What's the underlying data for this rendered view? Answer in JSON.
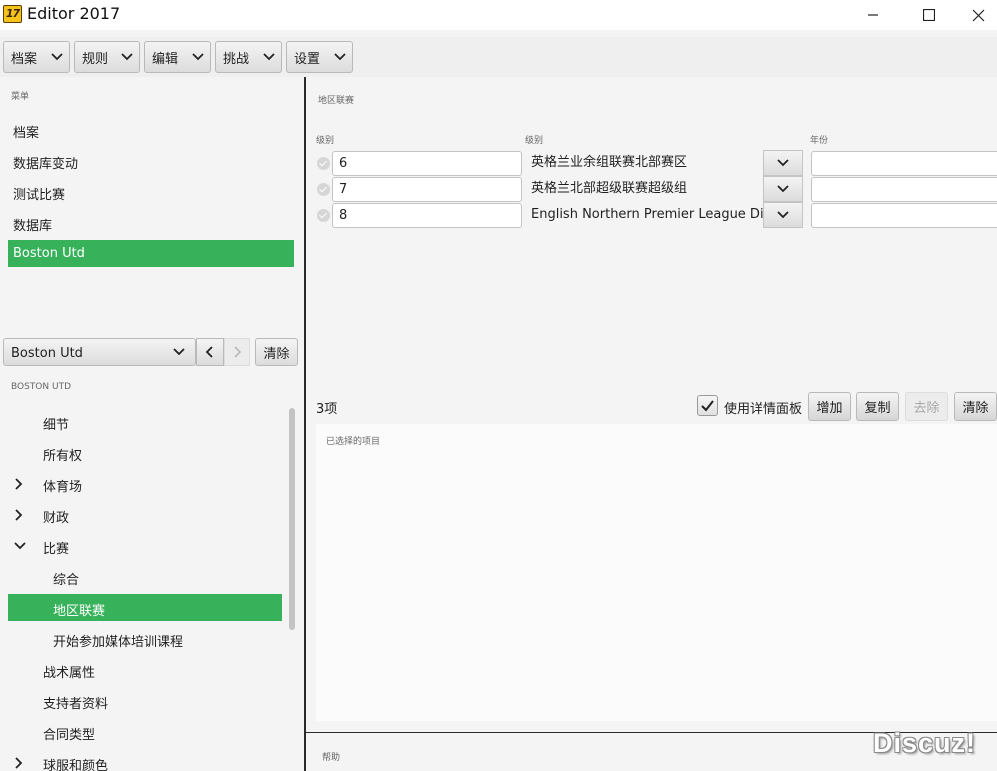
{
  "window": {
    "logo_text": "17",
    "title": "Editor 2017"
  },
  "top_menu": [
    {
      "label": "档案"
    },
    {
      "label": "规则"
    },
    {
      "label": "编辑"
    },
    {
      "label": "挑战"
    },
    {
      "label": "设置"
    }
  ],
  "sidebar": {
    "section_label": "菜单",
    "items": [
      {
        "label": "档案"
      },
      {
        "label": "数据库变动"
      },
      {
        "label": "测试比赛"
      },
      {
        "label": "数据库"
      },
      {
        "label": "Boston Utd"
      }
    ],
    "club_select": "Boston Utd",
    "clear_label": "清除",
    "club_header": "BOSTON UTD",
    "tree": [
      {
        "label": "细节",
        "expander": ""
      },
      {
        "label": "所有权",
        "expander": ""
      },
      {
        "label": "体育场",
        "expander": "collapsed"
      },
      {
        "label": "财政",
        "expander": "collapsed"
      },
      {
        "label": "比赛",
        "expander": "expanded"
      },
      {
        "label": "综合",
        "expander": ""
      },
      {
        "label": "地区联赛",
        "expander": ""
      },
      {
        "label": "开始参加媒体培训课程",
        "expander": ""
      },
      {
        "label": "战术属性",
        "expander": ""
      },
      {
        "label": "支持者资料",
        "expander": ""
      },
      {
        "label": "合同类型",
        "expander": ""
      },
      {
        "label": "球服和颜色",
        "expander": "collapsed"
      }
    ]
  },
  "main": {
    "section_title": "地区联赛",
    "columns": {
      "level": "级别",
      "league": "级别",
      "year": "年份"
    },
    "rows": [
      {
        "level": "6",
        "league": "英格兰业余组联赛北部赛区",
        "year": ""
      },
      {
        "level": "7",
        "league": "英格兰北部超级联赛超级组",
        "year": ""
      },
      {
        "level": "8",
        "league": "English Northern Premier League Divi...",
        "year": ""
      }
    ],
    "count": "3项",
    "detail_panel_label": "使用详情面板",
    "buttons": {
      "add": "增加",
      "copy": "复制",
      "remove": "去除",
      "clear": "清除"
    },
    "selected_label": "已选择的项目",
    "help_label": "帮助"
  },
  "watermark": "Discuz!",
  "colors": {
    "accent_green": "#37b25a",
    "logo_yellow": "#f6c21c"
  }
}
